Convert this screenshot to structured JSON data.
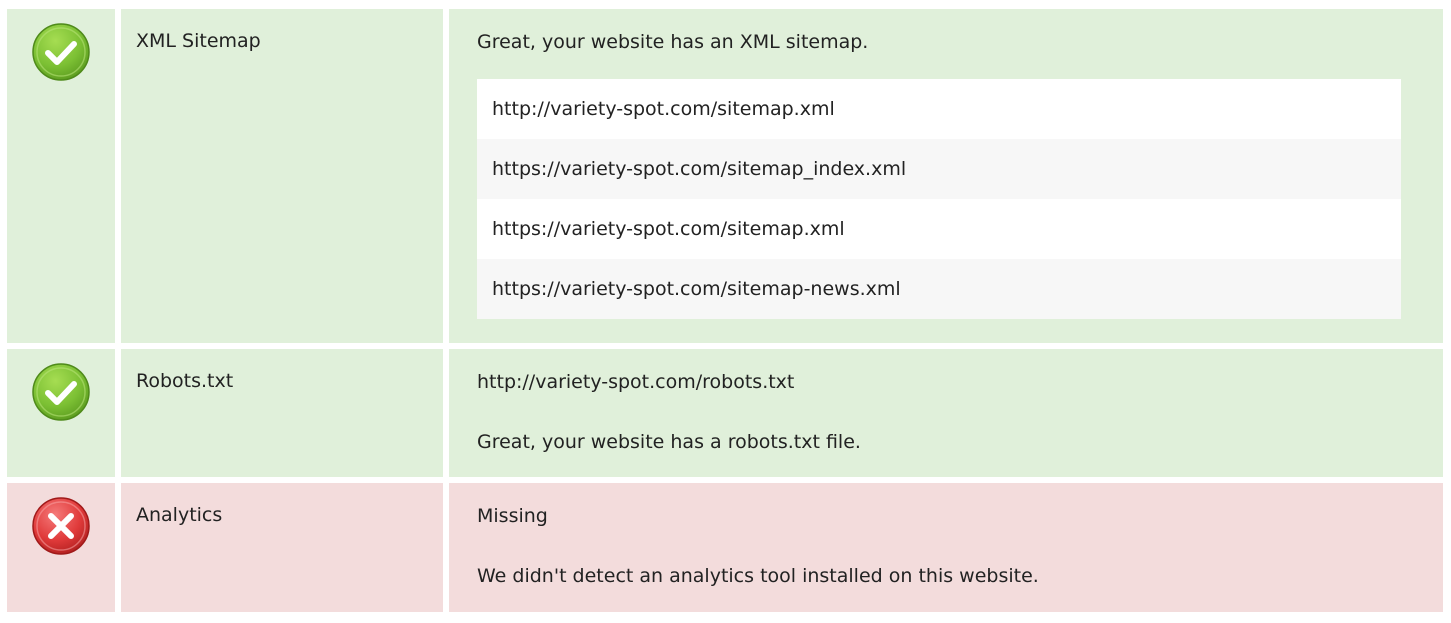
{
  "checks": [
    {
      "name": "XML Sitemap",
      "status": "pass",
      "icon": "check-circle-icon",
      "summary": "Great, your website has an XML sitemap.",
      "urls": [
        "http://variety-spot.com/sitemap.xml",
        "https://variety-spot.com/sitemap_index.xml",
        "https://variety-spot.com/sitemap.xml",
        "https://variety-spot.com/sitemap-news.xml"
      ]
    },
    {
      "name": "Robots.txt",
      "status": "pass",
      "icon": "check-circle-icon",
      "lines": [
        "http://variety-spot.com/robots.txt",
        "Great, your website has a robots.txt file."
      ]
    },
    {
      "name": "Analytics",
      "status": "fail",
      "icon": "x-circle-icon",
      "lines": [
        "Missing",
        "We didn't detect an analytics tool installed on this website."
      ]
    }
  ],
  "colors": {
    "pass_background": "#e0f0da",
    "fail_background": "#f3dcdc",
    "pass_icon": "#7cc034",
    "fail_icon": "#e03a3a"
  }
}
